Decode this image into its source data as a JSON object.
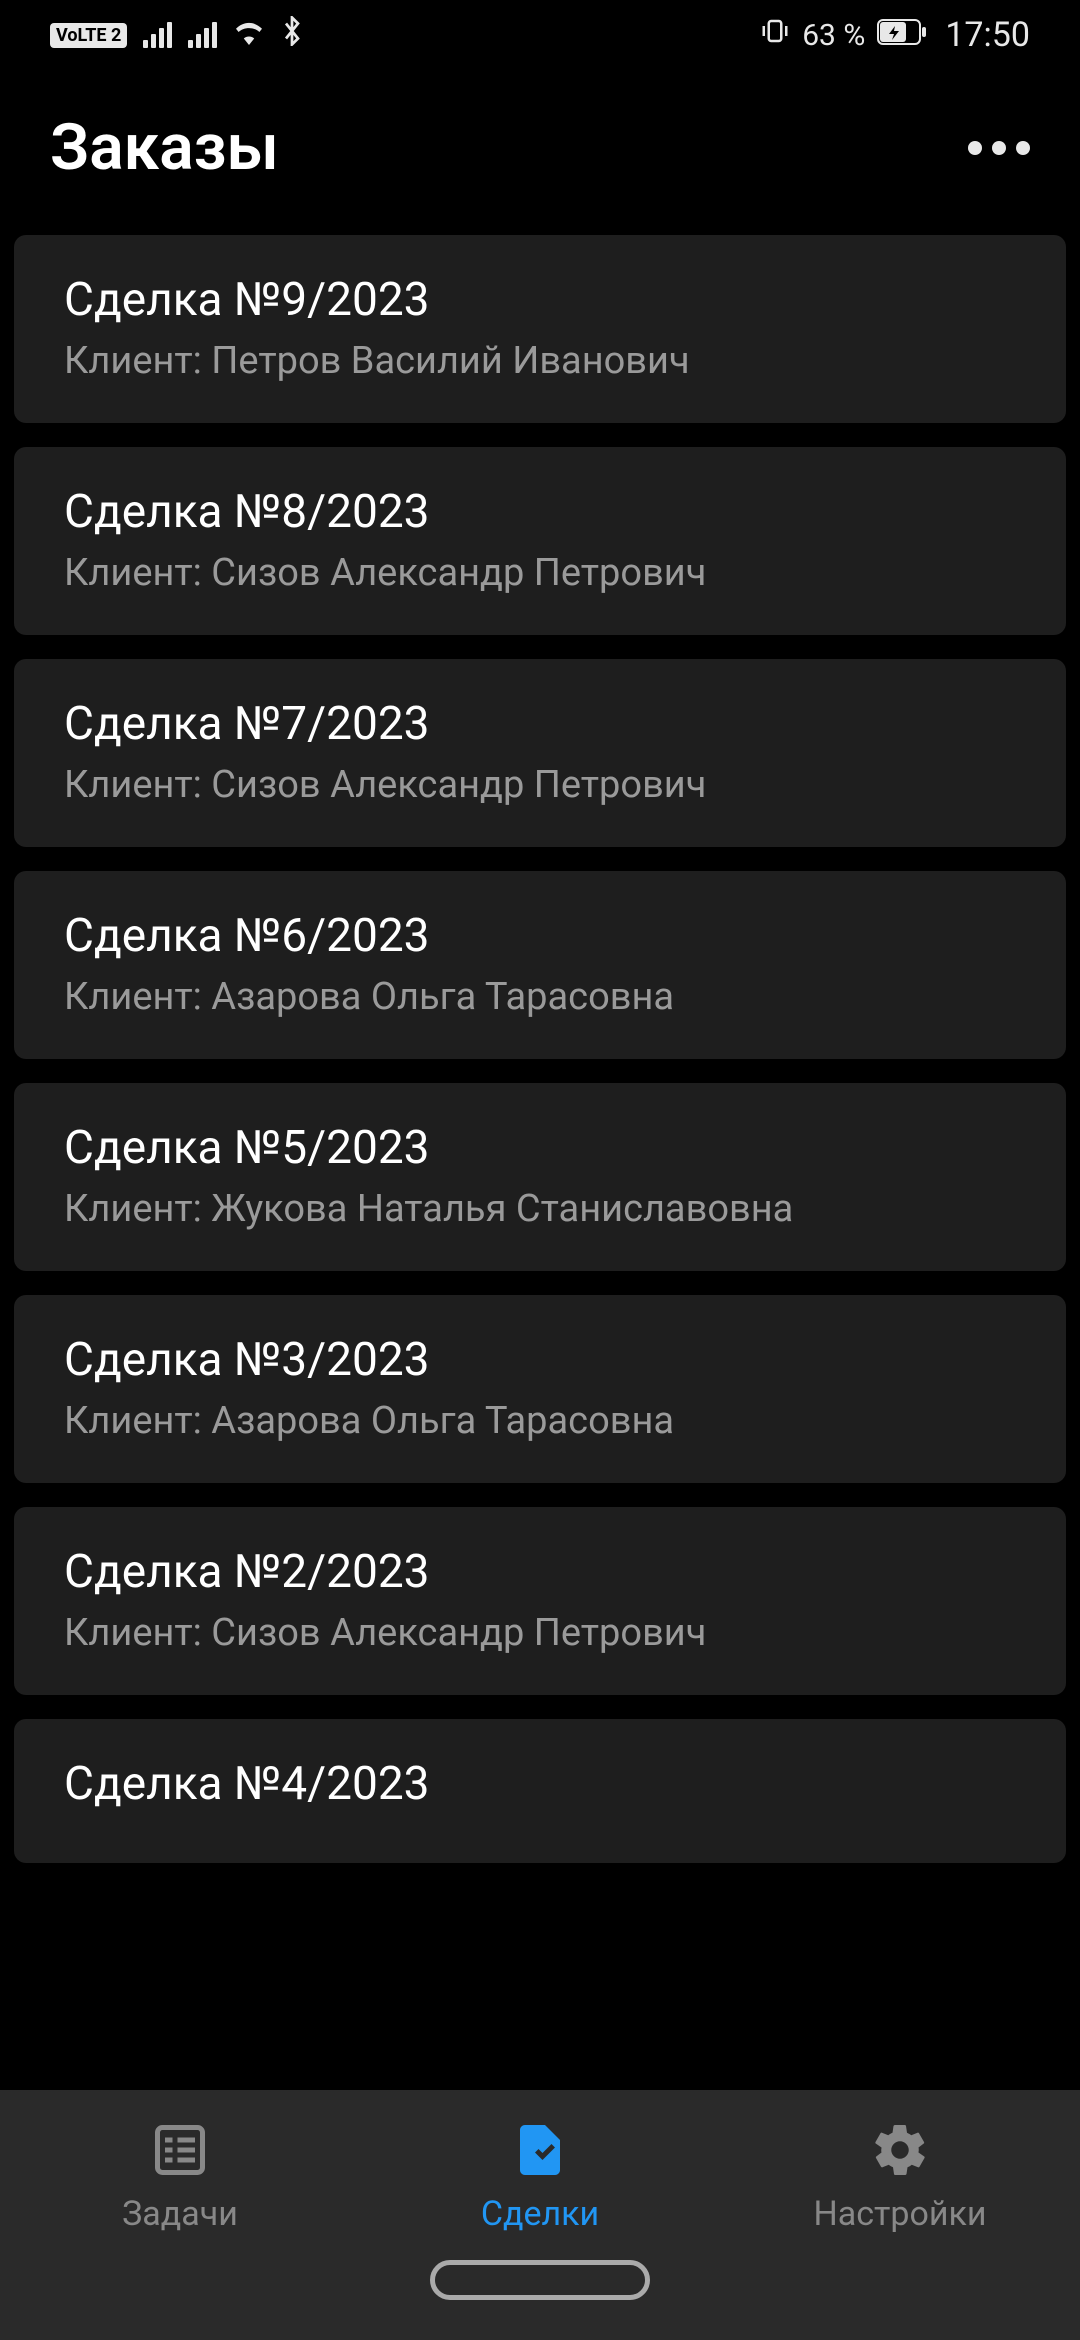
{
  "status_bar": {
    "volte": "VoLTE",
    "sim": "2",
    "battery_percent": "63 %",
    "time": "17:50"
  },
  "header": {
    "title": "Заказы"
  },
  "deals": [
    {
      "title": "Сделка №9/2023",
      "client": "Клиент: Петров Василий Иванович"
    },
    {
      "title": "Сделка №8/2023",
      "client": "Клиент: Сизов Александр Петрович"
    },
    {
      "title": "Сделка №7/2023",
      "client": "Клиент: Сизов Александр Петрович"
    },
    {
      "title": "Сделка №6/2023",
      "client": "Клиент: Азарова Ольга Тарасовна"
    },
    {
      "title": "Сделка №5/2023",
      "client": "Клиент: Жукова Наталья Станиславовна"
    },
    {
      "title": "Сделка №3/2023",
      "client": "Клиент: Азарова Ольга Тарасовна"
    },
    {
      "title": "Сделка №2/2023",
      "client": "Клиент: Сизов Александр Петрович"
    },
    {
      "title": "Сделка №4/2023",
      "client": ""
    }
  ],
  "nav": {
    "tasks": "Задачи",
    "deals": "Сделки",
    "settings": "Настройки"
  }
}
